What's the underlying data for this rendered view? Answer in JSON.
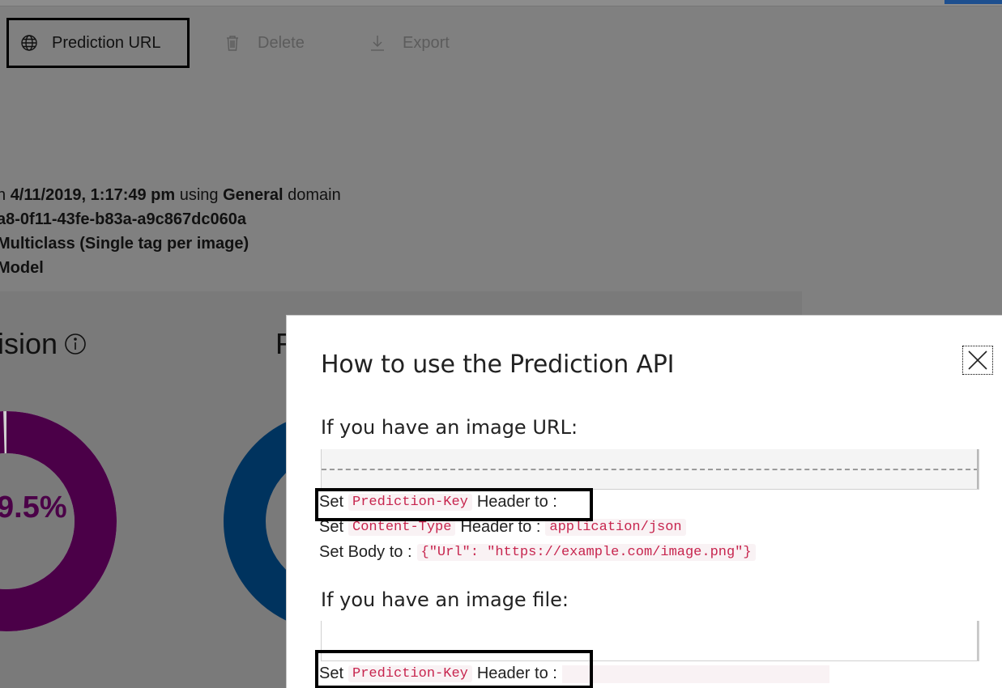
{
  "toolbar": {
    "prediction_url_label": "Prediction URL",
    "delete_label": "Delete",
    "export_label": "Export",
    "icons": {
      "prediction": "globe-icon",
      "delete": "trash-icon",
      "export": "download-icon"
    }
  },
  "iteration_info": {
    "line1_prefix": "n ",
    "line1_date": "4/11/2019, 1:17:49 pm",
    "line1_using": " using ",
    "line1_domain": "General",
    "line1_suffix": " domain",
    "line2": "a8-0f11-43fe-b83a-a9c867dc060a",
    "line3": "Multiclass (Single tag per image)",
    "line4": "Model"
  },
  "metrics": {
    "precision_title": "ision",
    "recall_title": "R",
    "precision_value_label": "9.5%",
    "precision_fraction": 0.995,
    "precision_color": "#4b0048",
    "recall_color": "#00335e"
  },
  "modal": {
    "title": "How to use the Prediction API",
    "close_icon": "close-icon",
    "url_section_heading": "If you have an image URL:",
    "file_section_heading": "If you have an image file:",
    "set_word": "Set",
    "header_to": "Header to :",
    "prediction_key": "Prediction-Key",
    "content_type": "Content-Type",
    "content_type_value": "application/json",
    "body_label": "Set Body to :",
    "body_value": "{\"Url\": \"https://example.com/image.png\"}"
  },
  "colors": {
    "overlay": "#808080",
    "code_text": "#c7254e",
    "code_bg": "#f9f2f4",
    "accent": "#1d4f8f"
  }
}
